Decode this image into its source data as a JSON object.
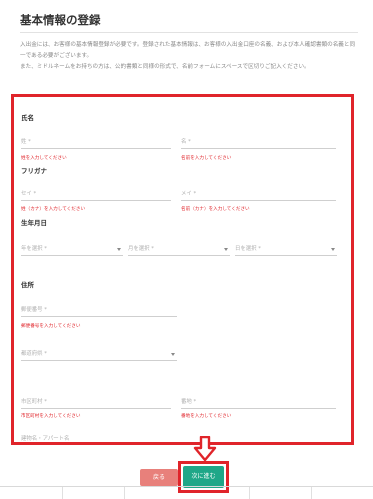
{
  "header": {
    "title": "基本情報の登録",
    "intro_1": "入出金には、お客様の基本情報登録が必要です。登録された基本情報は、お客様の入出金口座の名義、および本人確認書類の名義と同一である必要がございます。",
    "intro_2": "また、ミドルネームをお持ちの方は、公的書類と同様の形式で、名前フォームにスペースで区切りご記入ください。"
  },
  "sections": {
    "name": "氏名",
    "furigana": "フリガナ",
    "birthdate": "生年月日",
    "address": "住所"
  },
  "fields": {
    "last_name": {
      "placeholder": "姓 *",
      "error": "姓を入力してください"
    },
    "first_name": {
      "placeholder": "名 *",
      "error": "名前を入力してください"
    },
    "last_kana": {
      "placeholder": "セイ *",
      "error": "姓（カナ）を入力してください"
    },
    "first_kana": {
      "placeholder": "メイ *",
      "error": "名前（カナ）を入力してください"
    },
    "birth_year": {
      "placeholder": "年を選択 *"
    },
    "birth_month": {
      "placeholder": "月を選択 *"
    },
    "birth_day": {
      "placeholder": "日を選択 *"
    },
    "postal_code": {
      "placeholder": "郵便番号 *",
      "error": "郵便番号を入力してください"
    },
    "prefecture": {
      "placeholder": "都道府県 *"
    },
    "city": {
      "placeholder": "市区町村 *",
      "error": "市区町村を入力してください"
    },
    "street": {
      "placeholder": "番地 *",
      "error": "番地を入力してください"
    },
    "building": {
      "placeholder": "建物名・アパート名"
    }
  },
  "buttons": {
    "back": "戻る",
    "next": "次に進む"
  },
  "colors": {
    "highlight": "#e0242a",
    "next_button": "#1fa788",
    "back_button": "#e8807b"
  }
}
